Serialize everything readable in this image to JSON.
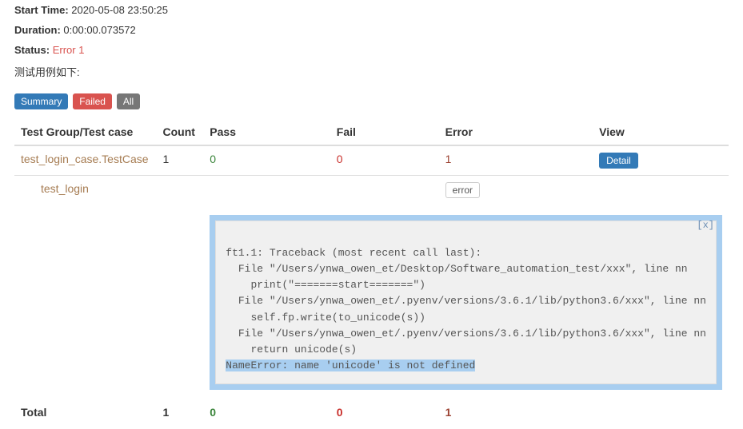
{
  "meta": {
    "start_time_label": "Start Time:",
    "start_time_value": "2020-05-08 23:50:25",
    "duration_label": "Duration:",
    "duration_value": "0:00:00.073572",
    "status_label": "Status:",
    "status_value": "Error 1",
    "desc": "测试用例如下:"
  },
  "filters": {
    "summary": "Summary",
    "failed": "Failed",
    "all": "All"
  },
  "headers": {
    "group": "Test Group/Test case",
    "count": "Count",
    "pass": "Pass",
    "fail": "Fail",
    "error": "Error",
    "view": "View"
  },
  "row1": {
    "name": "test_login_case.TestCase",
    "count": "1",
    "pass": "0",
    "fail": "0",
    "error": "1",
    "detail": "Detail"
  },
  "subrow": {
    "name": "test_login",
    "badge": "error"
  },
  "traceback": {
    "close": "[x]",
    "text": "ft1.1: Traceback (most recent call last):\n  File \"/Users/ynwa_owen_et/Desktop/Software_automation_test/xxx\", line nn\n    print(\"=======start=======\")\n  File \"/Users/ynwa_owen_et/.pyenv/versions/3.6.1/lib/python3.6/xxx\", line nn\n    self.fp.write(to_unicode(s))\n  File \"/Users/ynwa_owen_et/.pyenv/versions/3.6.1/lib/python3.6/xxx\", line nn\n    return unicode(s)",
    "highlight": "NameError: name 'unicode' is not defined"
  },
  "total": {
    "label": "Total",
    "count": "1",
    "pass": "0",
    "fail": "0",
    "error": "1"
  }
}
